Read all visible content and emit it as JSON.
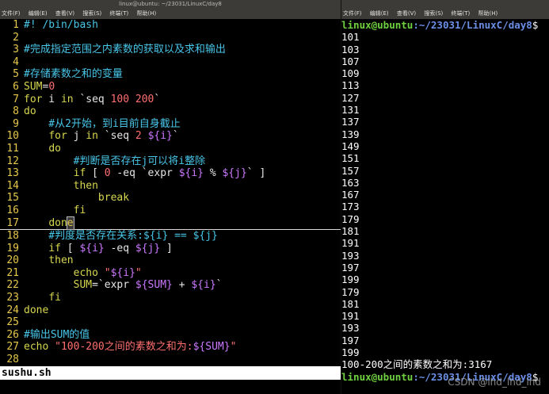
{
  "left_window": {
    "title": "linux@ubuntu: ~/23031/LinuxC/day8",
    "menu": [
      "文件(F)",
      "编辑(E)",
      "查看(V)",
      "搜索(S)",
      "终端(T)",
      "帮助(H)"
    ],
    "status_file": "sushu.sh"
  },
  "right_window": {
    "menu": [
      "文件(F)",
      "编辑(E)",
      "查看(V)",
      "搜索(S)",
      "终端(T)",
      "帮助(H)"
    ],
    "prompt_user": "linux@ubuntu",
    "prompt_path": ":~/23031/LinuxC/day8",
    "prompt_suffix": "$",
    "output": [
      "101",
      "103",
      "107",
      "109",
      "113",
      "127",
      "131",
      "137",
      "139",
      "149",
      "151",
      "157",
      "163",
      "167",
      "173",
      "179",
      "181",
      "191",
      "193",
      "197",
      "199",
      "179",
      "181",
      "191",
      "193",
      "197",
      "199"
    ],
    "result": "100-200之间的素数之和为:3167",
    "watermark": "CSDN @lhd_lhd_lhd"
  },
  "code_lines": [
    {
      "n": "1",
      "t": "#! /bin/bash"
    },
    {
      "n": "2",
      "t": ""
    },
    {
      "n": "3",
      "t": "#完成指定范围之内素数的获取以及求和输出"
    },
    {
      "n": "4",
      "t": ""
    },
    {
      "n": "5",
      "t": "#存储素数之和的变量"
    },
    {
      "n": "6",
      "t": "SUM=0"
    },
    {
      "n": "7",
      "t": "for i in `seq 100 200`"
    },
    {
      "n": "8",
      "t": "do"
    },
    {
      "n": "9",
      "t": "    #从2开始，到i目前自身截止"
    },
    {
      "n": "10",
      "t": "    for j in `seq 2 ${i}`"
    },
    {
      "n": "11",
      "t": "    do"
    },
    {
      "n": "12",
      "t": "        #判断是否存在j可以将i整除"
    },
    {
      "n": "13",
      "t": "        if [ 0 -eq `expr ${i} % ${j}` ]"
    },
    {
      "n": "14",
      "t": "        then"
    },
    {
      "n": "15",
      "t": "            break"
    },
    {
      "n": "16",
      "t": "        fi"
    },
    {
      "n": "17",
      "t": "    done"
    },
    {
      "n": "18",
      "t": "    #判度是否存在关系:${i} == ${j}"
    },
    {
      "n": "19",
      "t": "    if [ ${i} -eq ${j} ]"
    },
    {
      "n": "20",
      "t": "    then"
    },
    {
      "n": "21",
      "t": "        echo \"${i}\""
    },
    {
      "n": "22",
      "t": "        SUM=`expr ${SUM} + ${i}`"
    },
    {
      "n": "23",
      "t": "    fi"
    },
    {
      "n": "24",
      "t": "done"
    },
    {
      "n": "25",
      "t": ""
    },
    {
      "n": "26",
      "t": "#输出SUM的值"
    },
    {
      "n": "27",
      "t": "echo \"100-200之间的素数之和为:${SUM}\""
    },
    {
      "n": "28",
      "t": ""
    }
  ],
  "colors": {
    "keyword": "#d7d74f",
    "comment": "#48c6e8",
    "variable": "#cc78ff",
    "number": "#ff6f6f",
    "prompt_user": "#6fd13f",
    "prompt_path": "#6b8fe6"
  }
}
